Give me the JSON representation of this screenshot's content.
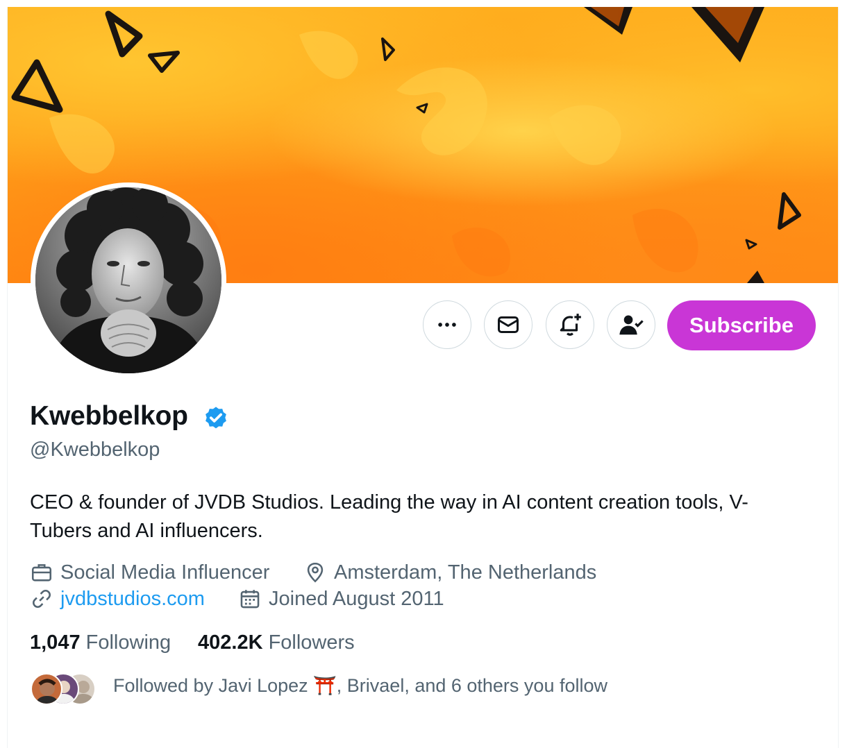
{
  "profile": {
    "name": "Kwebbelkop",
    "handle": "@Kwebbelkop",
    "verified": true,
    "bio": "CEO & founder of JVDB Studios. Leading the way in AI content creation tools, V-Tubers and AI influencers.",
    "category": "Social Media Influencer",
    "location": "Amsterdam, The Netherlands",
    "website": "jvdbstudios.com",
    "joined": "Joined August 2011"
  },
  "actions": {
    "more_icon": "more-dots-icon",
    "message_icon": "envelope-icon",
    "notify_icon": "bell-plus-icon",
    "following_icon": "person-check-icon",
    "subscribe_label": "Subscribe"
  },
  "stats": {
    "following_count": "1,047",
    "following_label": "Following",
    "followers_count": "402.2K",
    "followers_label": "Followers"
  },
  "followed_by": {
    "prefix": "Followed by Javi Lopez ",
    "emoji": "⛩️",
    "suffix": ", Brivael, and 6 others you follow"
  },
  "colors": {
    "subscribe": "#c936d6",
    "verified": "#1d9bf0",
    "link": "#1d9bf0",
    "secondary_text": "#536471",
    "banner": "#ff9f1c"
  }
}
